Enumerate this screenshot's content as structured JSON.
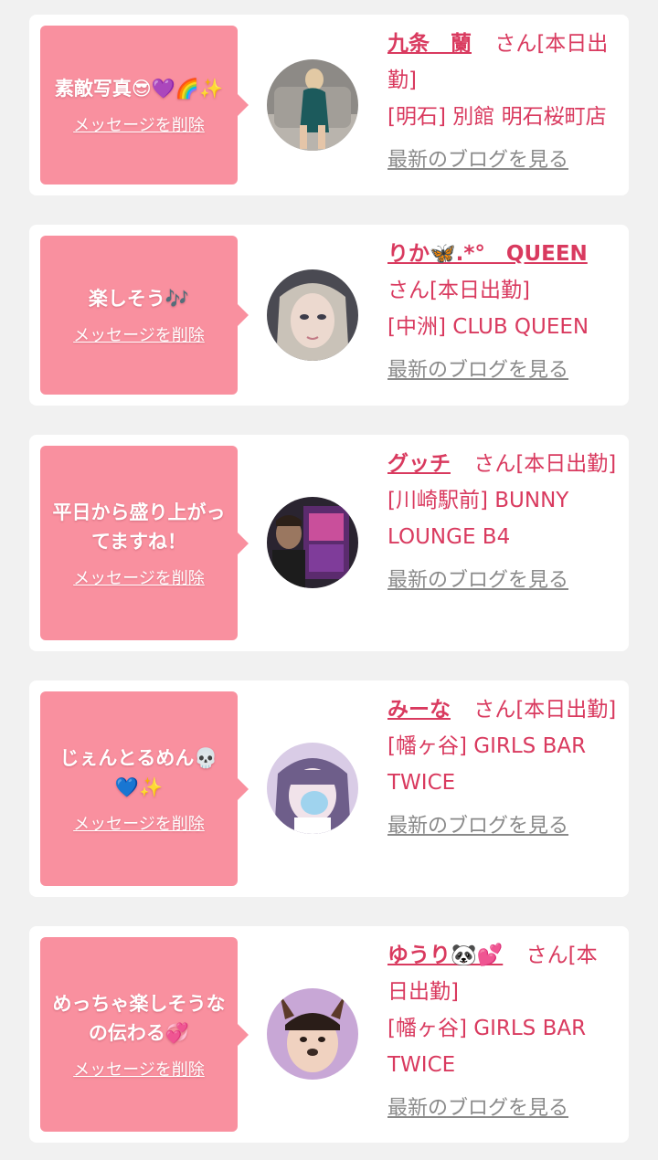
{
  "colors": {
    "accent": "#d93a5f",
    "bubble": "#f9909f",
    "page_bg": "#f1f1f1",
    "card_bg": "#ffffff",
    "link_gray": "#8a8a8a"
  },
  "cards": [
    {
      "message": "素敵写真😎💜🌈✨",
      "delete_label": "メッセージを削除",
      "name": "九条　蘭",
      "status": "さん[本日出勤]",
      "shop": "[明石] 別館 明石桜町店",
      "blog_label": "最新のブログを見る"
    },
    {
      "message": "楽しそう🎶",
      "delete_label": "メッセージを削除",
      "name": "りか🦋.*°　QUEEN",
      "status": "さん[本日出勤]",
      "shop": "[中洲] CLUB QUEEN",
      "blog_label": "最新のブログを見る"
    },
    {
      "message": "平日から盛り上がってますね！",
      "delete_label": "メッセージを削除",
      "name": "グッチ",
      "status": "さん[本日出勤]",
      "shop": "[川崎駅前] BUNNY LOUNGE B4",
      "blog_label": "最新のブログを見る"
    },
    {
      "message": "じぇんとるめん💀💙✨",
      "delete_label": "メッセージを削除",
      "name": "みーな",
      "status": "さん[本日出勤]",
      "shop": "[幡ヶ谷] GIRLS BAR TWICE",
      "blog_label": "最新のブログを見る"
    },
    {
      "message": "めっちゃ楽しそうなの伝わる💞",
      "delete_label": "メッセージを削除",
      "name": "ゆうり🐼💕",
      "status": "さん[本日出勤]",
      "shop": "[幡ヶ谷] GIRLS BAR TWICE",
      "blog_label": "最新のブログを見る"
    }
  ]
}
